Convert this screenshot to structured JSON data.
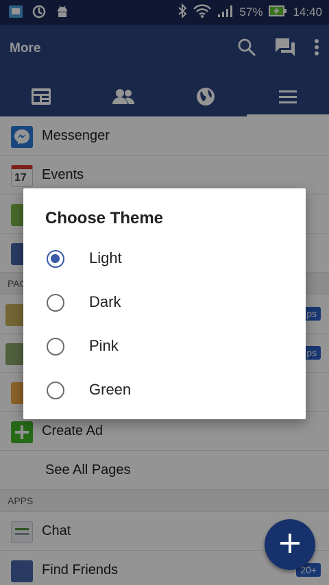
{
  "status_bar": {
    "battery_percent": "57%",
    "time": "14:40",
    "icons": [
      "screenshot-icon",
      "sync-icon",
      "android-icon",
      "bluetooth-icon",
      "wifi-icon",
      "signal-icon",
      "battery-charging-icon"
    ]
  },
  "app_bar": {
    "title": "More",
    "actions": [
      "search-icon",
      "messages-icon",
      "overflow-menu-icon"
    ],
    "tabs": [
      {
        "name": "news-feed-tab",
        "icon": "news-feed-icon"
      },
      {
        "name": "friends-tab",
        "icon": "friends-icon"
      },
      {
        "name": "notifications-tab",
        "icon": "globe-icon"
      },
      {
        "name": "more-tab",
        "icon": "menu-icon",
        "active": true
      }
    ]
  },
  "list": {
    "items": [
      {
        "label": "Messenger",
        "icon": "messenger-icon"
      },
      {
        "label": "Events",
        "icon": "calendar-icon",
        "icon_text": "17"
      },
      {
        "label": "",
        "icon": "nearby-icon"
      },
      {
        "label": "",
        "icon": "profile-icon"
      }
    ],
    "section_pages": "PAG",
    "pages_items": [
      {
        "label": "",
        "badge": "ps"
      },
      {
        "label": "",
        "badge": "ps"
      },
      {
        "label": "",
        "icon": "page-icon"
      },
      {
        "label": "Create Ad",
        "icon": "plus-icon"
      },
      {
        "label": "See All Pages"
      }
    ],
    "section_apps": "APPS",
    "apps_items": [
      {
        "label": "Chat",
        "icon": "chat-icon"
      },
      {
        "label": "Find Friends",
        "icon": "find-friends-icon",
        "badge": "20+"
      }
    ]
  },
  "dialog": {
    "title": "Choose Theme",
    "options": [
      {
        "label": "Light",
        "selected": true
      },
      {
        "label": "Dark",
        "selected": false
      },
      {
        "label": "Pink",
        "selected": false
      },
      {
        "label": "Green",
        "selected": false
      }
    ]
  },
  "colors": {
    "status_bar": "#1a2957",
    "app_bar": "#2c447f",
    "accent": "#3a5aa8",
    "fab": "#16316b"
  }
}
